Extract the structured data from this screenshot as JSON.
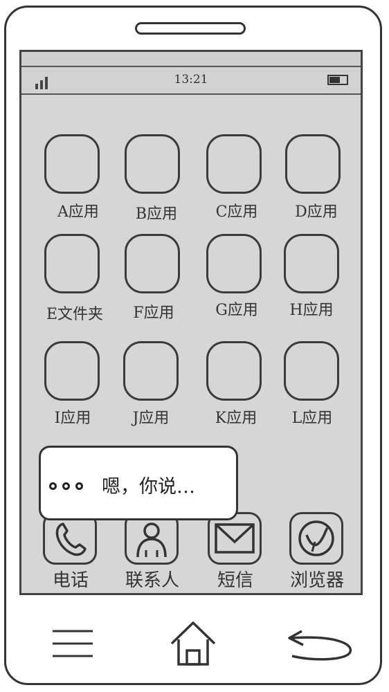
{
  "status": {
    "time": "13:21"
  },
  "apps": [
    {
      "label": "A应用"
    },
    {
      "label": "B应用"
    },
    {
      "label": "C应用"
    },
    {
      "label": "D应用"
    },
    {
      "label": "E文件夹"
    },
    {
      "label": "F应用"
    },
    {
      "label": "G应用"
    },
    {
      "label": "H应用"
    },
    {
      "label": "I应用"
    },
    {
      "label": "J应用"
    },
    {
      "label": "K应用"
    },
    {
      "label": "L应用"
    }
  ],
  "dock": [
    {
      "label": "电话",
      "icon": "phone-icon"
    },
    {
      "label": "联系人",
      "icon": "contacts-icon"
    },
    {
      "label": "短信",
      "icon": "envelope-icon"
    },
    {
      "label": "浏览器",
      "icon": "browser-icon"
    }
  ],
  "voice_bubble": {
    "text": "嗯，你说…"
  },
  "nav": {
    "menu_icon": "menu-icon",
    "home_icon": "home-icon",
    "back_icon": "back-icon"
  }
}
